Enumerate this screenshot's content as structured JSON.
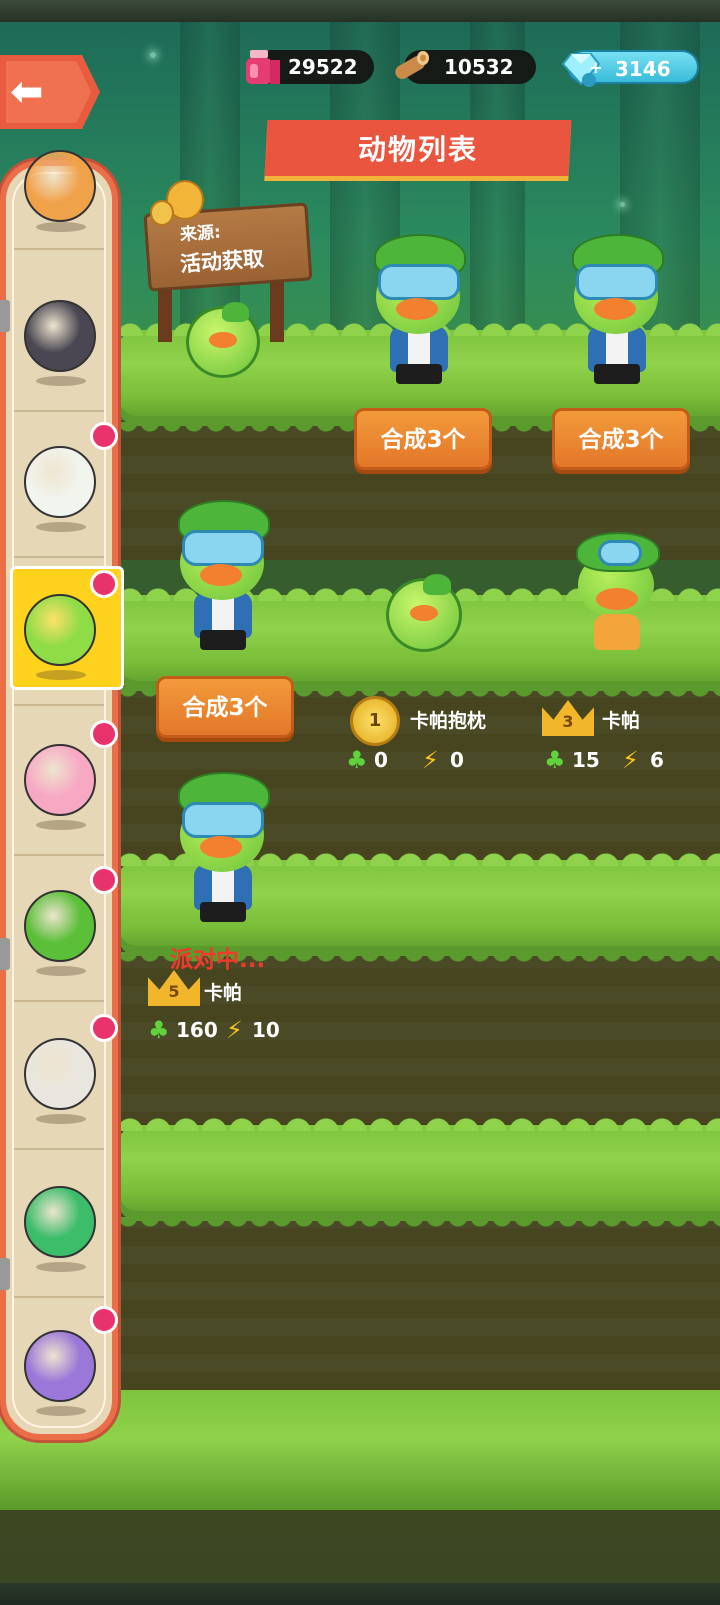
{
  "resources": {
    "ink": {
      "value": "29522",
      "icon": "ink-bottle-icon"
    },
    "wood": {
      "value": "10532",
      "icon": "wood-log-icon"
    },
    "gems": {
      "value": "3146",
      "icon": "gem-icon",
      "add_icon": "plus-icon"
    }
  },
  "title": "动物列表",
  "source": {
    "label": "来源:",
    "value": "活动获取"
  },
  "merge_buttons": [
    {
      "label": "合成3个"
    },
    {
      "label": "合成3个"
    },
    {
      "label": "合成3个"
    }
  ],
  "items": [
    {
      "level": "1",
      "name": "卡帕抱枕",
      "clover": "0",
      "energy": "0",
      "badge": "medal"
    },
    {
      "level": "3",
      "name": "卡帕",
      "clover": "15",
      "energy": "6",
      "badge": "crown"
    },
    {
      "level": "5",
      "name": "卡帕",
      "clover": "160",
      "energy": "10",
      "badge": "crown",
      "status": "派对中..."
    }
  ],
  "sidebar": {
    "selected_index": 3,
    "animals": [
      {
        "name": "orange-animal",
        "color": "#f0a24a",
        "has_dot": false
      },
      {
        "name": "black-panther",
        "color": "#4a4752",
        "has_dot": false
      },
      {
        "name": "panda",
        "color": "#f2f4ee",
        "has_dot": true
      },
      {
        "name": "kappa-duck",
        "color": "#8fdc47",
        "has_dot": true
      },
      {
        "name": "pink-bear",
        "color": "#f7a9c4",
        "has_dot": true
      },
      {
        "name": "green-cabbage",
        "color": "#5cbf3a",
        "has_dot": true
      },
      {
        "name": "snow-leopard",
        "color": "#e9e6df",
        "has_dot": true
      },
      {
        "name": "green-bird",
        "color": "#3bbd6a",
        "has_dot": false
      },
      {
        "name": "purple-seal",
        "color": "#9a77d8",
        "has_dot": true
      }
    ]
  }
}
